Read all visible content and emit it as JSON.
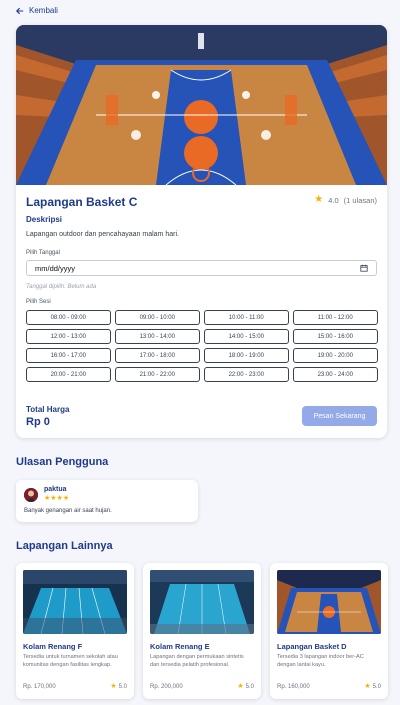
{
  "nav": {
    "back_label": "Kembali"
  },
  "court": {
    "name": "Lapangan Basket C",
    "rating": "4.0",
    "reviews_count": "(1 ulasan)",
    "description_heading": "Deskripsi",
    "description": "Lapangan outdoor dan pencahayaan malam hari."
  },
  "booking": {
    "date_label": "Pilih Tanggal",
    "date_placeholder": "mm/dd/yyyy",
    "date_note": "Tanggal dipilih: Belum ada",
    "session_label": "Pilih Sesi",
    "slots": [
      "08:00 - 09:00",
      "09:00 - 10:00",
      "10:00 - 11:00",
      "11:00 - 12:00",
      "12:00 - 13:00",
      "13:00 - 14:00",
      "14:00 - 15:00",
      "15:00 - 16:00",
      "16:00 - 17:00",
      "17:00 - 18:00",
      "18:00 - 19:00",
      "19:00 - 20:00",
      "20:00 - 21:00",
      "21:00 - 22:00",
      "22:00 - 23:00",
      "23:00 - 24:00"
    ],
    "total_label": "Total Harga",
    "total_value": "Rp 0",
    "book_button": "Pesan Sekarang"
  },
  "reviews": {
    "heading": "Ulasan Pengguna",
    "items": [
      {
        "user": "paktua",
        "stars": "★★★★",
        "text": "Banyak genangan air saat hujan."
      }
    ]
  },
  "others": {
    "heading": "Lapangan Lainnya",
    "items": [
      {
        "name": "Kolam Renang F",
        "desc": "Tersedia untuk turnamen sekolah atau komunitas dengan fasilitas lengkap.",
        "price": "Rp. 170,000",
        "rating": "5.0"
      },
      {
        "name": "Kolam Renang E",
        "desc": "Lapangan dengan permukaan sintetis dan tersedia pelatih profesional.",
        "price": "Rp. 200,000",
        "rating": "5.0"
      },
      {
        "name": "Lapangan Basket D",
        "desc": "Tersedia 3 lapangan indoor ber-AC dengan lantai kayu.",
        "price": "Rp. 160,000",
        "rating": "5.0"
      }
    ]
  },
  "colors": {
    "primary": "#1e3a8a",
    "button_disabled": "#93a9e8",
    "star": "#f5b301"
  }
}
